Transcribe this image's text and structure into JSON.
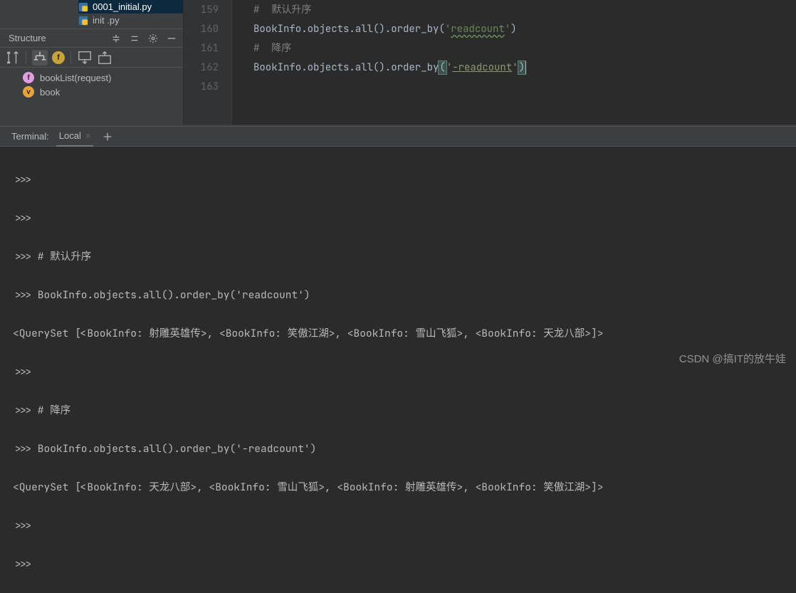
{
  "files": {
    "item0": {
      "name": "0001_initial.py"
    },
    "item1": {
      "name": "init   .py"
    }
  },
  "structure": {
    "title": "Structure",
    "items": [
      {
        "icon": "f",
        "label": "bookList(request)"
      },
      {
        "icon": "v",
        "label": "book"
      }
    ]
  },
  "editor": {
    "lines": [
      {
        "num": "159",
        "type": "comment",
        "text": "#  默认升序"
      },
      {
        "num": "160",
        "type": "code_asc"
      },
      {
        "num": "161",
        "type": "blank",
        "text": ""
      },
      {
        "num": "162",
        "type": "comment",
        "text": "#  降序"
      },
      {
        "num": "163",
        "type": "code_desc"
      }
    ],
    "asc": {
      "prefix": "BookInfo.objects.all().order_by(",
      "arg_q": "'",
      "arg": "readcount",
      "suffix": ")"
    },
    "desc": {
      "prefix": "BookInfo.objects.all().order_by",
      "open": "(",
      "arg_q": "'",
      "arg": "-readcount",
      "close": ")"
    }
  },
  "terminal": {
    "title": "Terminal:",
    "tab": "Local",
    "lines": [
      ">>>",
      ">>>",
      ">>> # 默认升序",
      ">>> BookInfo.objects.all().order_by('readcount')",
      "<QuerySet [<BookInfo: 射雕英雄传>, <BookInfo: 笑傲江湖>, <BookInfo: 雪山飞狐>, <BookInfo: 天龙八部>]>",
      ">>>",
      ">>> # 降序",
      ">>> BookInfo.objects.all().order_by('-readcount')",
      "<QuerySet [<BookInfo: 天龙八部>, <BookInfo: 雪山飞狐>, <BookInfo: 射雕英雄传>, <BookInfo: 笑傲江湖>]>",
      ">>>",
      ">>>"
    ]
  },
  "watermark": "CSDN @搞IT的放牛娃"
}
